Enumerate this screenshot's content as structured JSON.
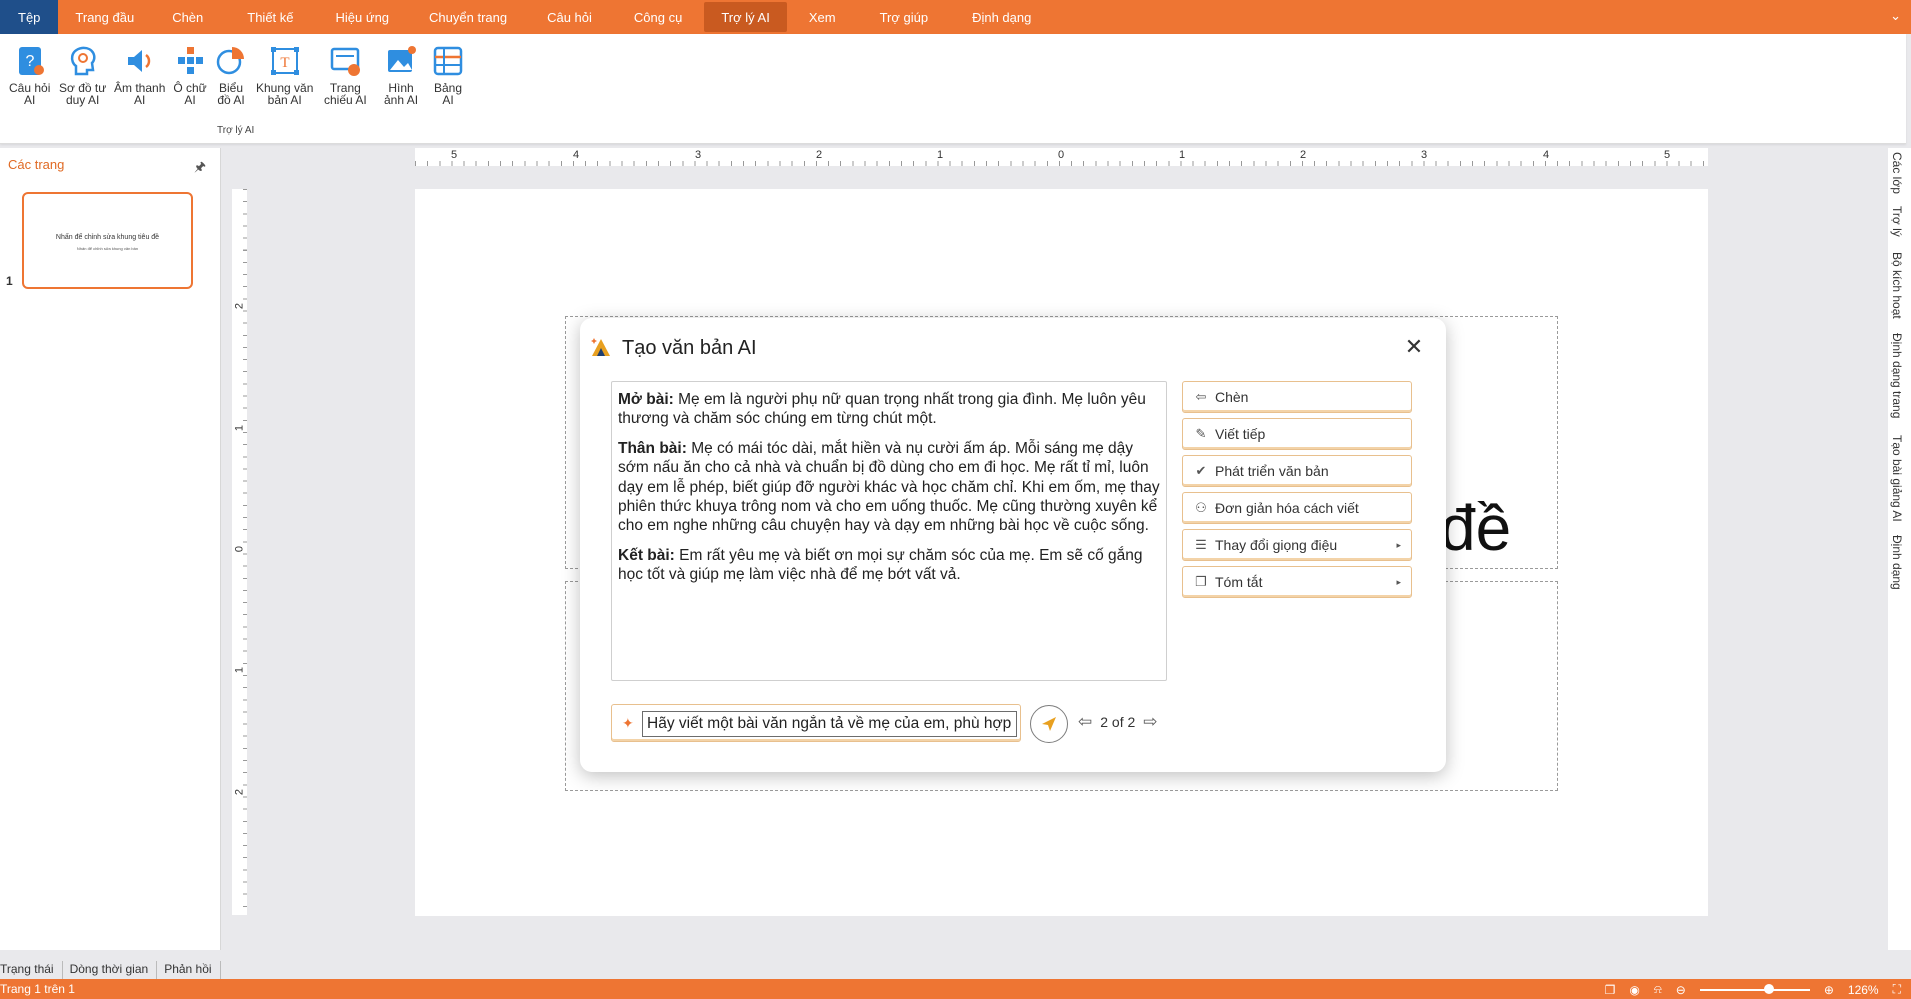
{
  "menubar": {
    "file": "Tệp",
    "items": [
      "Trang đầu",
      "Chèn",
      "Thiết kế",
      "Hiệu ứng",
      "Chuyển trang",
      "Câu hỏi",
      "Công cụ",
      "Trợ lý AI",
      "Xem",
      "Trợ giúp",
      "Định dạng"
    ],
    "active_index": 7,
    "caret": "⌄"
  },
  "ribbon": {
    "buttons": [
      {
        "line1": "Câu hỏi",
        "line2": "AI",
        "icon": "quiz-ai-icon"
      },
      {
        "line1": "Sơ đồ tư",
        "line2": "duy AI",
        "icon": "mindmap-ai-icon"
      },
      {
        "line1": "Âm thanh",
        "line2": "AI",
        "icon": "audio-ai-icon"
      },
      {
        "line1": "Ô chữ",
        "line2": "AI",
        "icon": "crossword-ai-icon"
      },
      {
        "line1": "Biểu",
        "line2": "đồ AI",
        "icon": "chart-ai-icon"
      },
      {
        "line1": "Khung văn",
        "line2": "bản AI",
        "icon": "textbox-ai-icon"
      },
      {
        "line1": "Trang",
        "line2": "chiếu AI",
        "icon": "slide-ai-icon"
      },
      {
        "line1": "Hình",
        "line2": "ảnh AI",
        "icon": "image-ai-icon"
      },
      {
        "line1": "Bảng",
        "line2": "AI",
        "icon": "table-ai-icon"
      }
    ],
    "group_label": "Trợ lý AI"
  },
  "slides_panel": {
    "title": "Các trang",
    "slide_number": "1",
    "thumb_title": "Nhấn để chỉnh sửa khung tiêu đề",
    "thumb_subtitle": "Nhấn để chỉnh sửa khung văn bản"
  },
  "ruler": {
    "h_labels": [
      "5",
      "4",
      "3",
      "2",
      "1",
      "0",
      "1",
      "2",
      "3",
      "4",
      "5"
    ],
    "v_labels": [
      "2",
      "1",
      "0",
      "1",
      "2"
    ]
  },
  "slide": {
    "title_fragment": "đề"
  },
  "right_tabs": [
    "Các lớp",
    "Trợ lý",
    "Bộ kích hoạt",
    "Định dạng trang",
    "Tạo bài giảng AI",
    "Định dạng"
  ],
  "status_tabs": [
    "Trạng thái",
    "Dòng thời gian",
    "Phản hồi"
  ],
  "statusbar": {
    "page": "Trang 1 trên 1",
    "zoom": "126%",
    "zoom_fraction": 0.58
  },
  "dialog": {
    "title": "Tạo văn bản AI",
    "paragraphs": [
      {
        "label": "Mở bài:",
        "text": " Mẹ em là người phụ nữ quan trọng nhất trong gia đình. Mẹ luôn yêu thương và chăm sóc chúng em từng chút một."
      },
      {
        "label": "Thân bài:",
        "text": " Mẹ có mái tóc dài, mắt hiền và nụ cười ấm áp. Mỗi sáng mẹ dậy sớm nấu ăn cho cả nhà và chuẩn bị đồ dùng cho em đi học. Mẹ rất tỉ mỉ, luôn dạy em lễ phép, biết giúp đỡ người khác và học chăm chỉ. Khi em ốm, mẹ thay phiên thức khuya trông nom và cho em uống thuốc. Mẹ cũng thường xuyên kể cho em nghe những câu chuyện hay và dạy em những bài học về cuộc sống."
      },
      {
        "label": "Kết bài:",
        "text": " Em rất yêu mẹ và biết ơn mọi sự chăm sóc của mẹ. Em sẽ cố gắng học tốt và giúp mẹ làm việc nhà để mẹ bớt vất vả."
      }
    ],
    "actions": [
      {
        "label": "Chèn",
        "icon": "insert-icon",
        "glyph": "⇦",
        "submenu": false
      },
      {
        "label": "Viết tiếp",
        "icon": "continue-writing-icon",
        "glyph": "✎",
        "submenu": false
      },
      {
        "label": "Phát triển văn bản",
        "icon": "expand-text-icon",
        "glyph": "✔",
        "submenu": false
      },
      {
        "label": "Đơn giản hóa cách viết",
        "icon": "simplify-icon",
        "glyph": "⚇",
        "submenu": false
      },
      {
        "label": "Thay đổi giọng điệu",
        "icon": "change-tone-icon",
        "glyph": "☰",
        "submenu": true
      },
      {
        "label": "Tóm tắt",
        "icon": "summarize-icon",
        "glyph": "❐",
        "submenu": true
      }
    ],
    "prompt_value": "Hãy viết một bài văn ngắn tả về mẹ của em, phù hợp",
    "pager": "2 of 2"
  },
  "colors": {
    "accent": "#ee7533",
    "file_tab": "#1f4f8a"
  }
}
